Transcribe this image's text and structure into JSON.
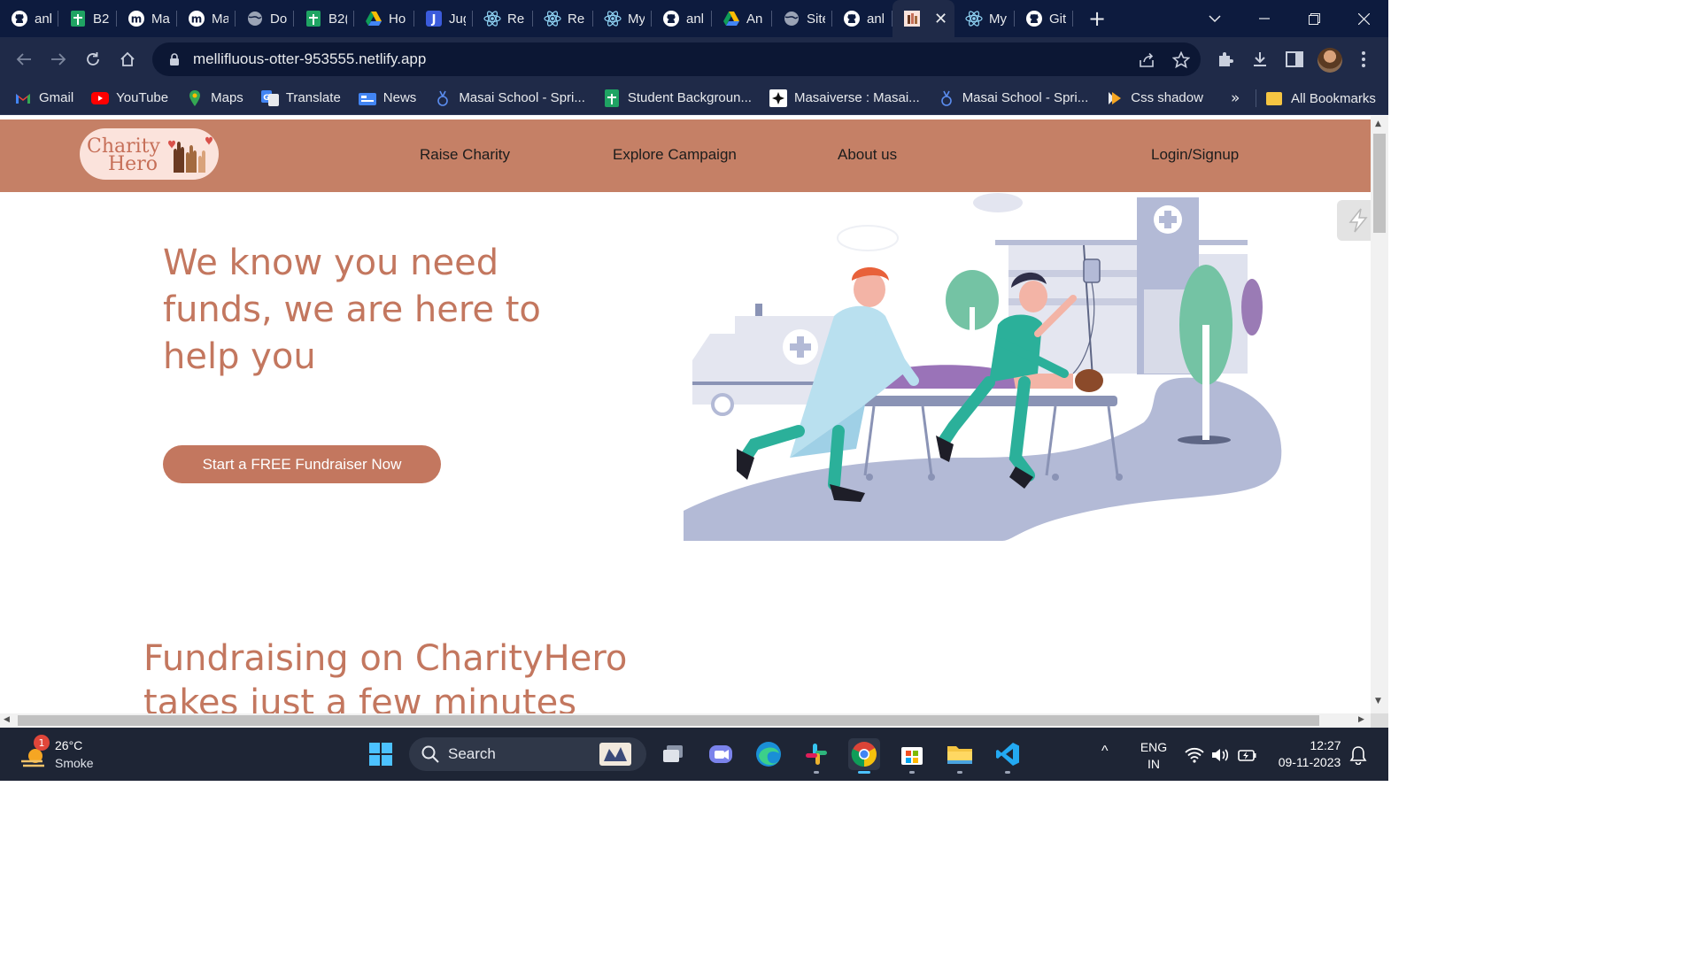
{
  "browser": {
    "tabs": [
      {
        "label": "anl",
        "icon": "github-icon"
      },
      {
        "label": "B2",
        "icon": "google-sheets-icon"
      },
      {
        "label": "Ma",
        "icon": "medium-icon"
      },
      {
        "label": "Ma",
        "icon": "medium-icon"
      },
      {
        "label": "Do",
        "icon": "globe-icon"
      },
      {
        "label": "B2(",
        "icon": "google-sheets-icon"
      },
      {
        "label": "Ho",
        "icon": "google-drive-icon"
      },
      {
        "label": "Jug",
        "icon": "jugaad-icon"
      },
      {
        "label": "Re",
        "icon": "react-icon"
      },
      {
        "label": "Re",
        "icon": "react-icon"
      },
      {
        "label": "My",
        "icon": "react-icon"
      },
      {
        "label": "anl",
        "icon": "github-icon"
      },
      {
        "label": "An",
        "icon": "google-drive-icon"
      },
      {
        "label": "Site",
        "icon": "globe-icon"
      },
      {
        "label": "anl",
        "icon": "github-icon"
      },
      {
        "label": "",
        "icon": "charityhero-favicon",
        "active": true
      },
      {
        "label": "My",
        "icon": "react-icon"
      },
      {
        "label": "Git",
        "icon": "github-icon"
      }
    ],
    "url": "mellifluous-otter-953555.netlify.app",
    "bookmarks": [
      {
        "label": "Gmail",
        "icon": "gmail-icon"
      },
      {
        "label": "YouTube",
        "icon": "youtube-icon"
      },
      {
        "label": "Maps",
        "icon": "maps-icon"
      },
      {
        "label": "Translate",
        "icon": "translate-icon"
      },
      {
        "label": "News",
        "icon": "news-icon"
      },
      {
        "label": "Masai School - Spri...",
        "icon": "masai-icon"
      },
      {
        "label": "Student Backgroun...",
        "icon": "google-sheets-icon"
      },
      {
        "label": "Masaiverse : Masai...",
        "icon": "masaiverse-icon"
      },
      {
        "label": "Masai School - Spri...",
        "icon": "masai-icon"
      },
      {
        "label": "Css shadow",
        "icon": "css-shadow-icon"
      }
    ],
    "bookmarks_more": "»",
    "all_bookmarks": "All Bookmarks"
  },
  "site": {
    "logo_text_1": "Charity",
    "logo_text_2": "Hero",
    "nav": {
      "raise": "Raise Charity",
      "explore": "Explore Campaign",
      "about": "About us",
      "login": "Login/Signup"
    },
    "hero_title": "We know you need funds, we are here to help you",
    "cta_label": "Start a FREE Fundraiser Now",
    "section_title": "Fundraising on CharityHero takes just a few minutes"
  },
  "taskbar": {
    "temperature": "26°C",
    "condition": "Smoke",
    "weather_badge": "1",
    "search_label": "Search",
    "lang_1": "ENG",
    "lang_2": "IN",
    "time": "12:27",
    "date": "09-11-2023"
  },
  "colors": {
    "browser_frame": "#1f2a48",
    "tab_strip": "#0d1b3e",
    "site_nav": "#c58066",
    "site_accent": "#c3775f",
    "taskbar": "#1e2535"
  }
}
